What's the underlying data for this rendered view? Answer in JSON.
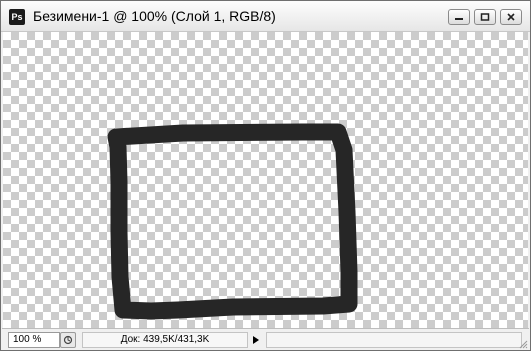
{
  "window": {
    "app_icon_label": "Ps",
    "title": "Безимени-1 @ 100% (Слой 1, RGB/8)"
  },
  "controls": {
    "minimize_icon": "minimize-icon",
    "maximize_icon": "maximize-icon",
    "close_icon": "close-icon"
  },
  "canvas": {
    "background": "transparency-checkerboard",
    "stroke_color": "#262626"
  },
  "statusbar": {
    "zoom": "100 %",
    "doc_info": "Док: 439,5K/431,3K",
    "nav_icon": "navigate-icon",
    "menu_arrow_icon": "triangle-right-icon"
  }
}
